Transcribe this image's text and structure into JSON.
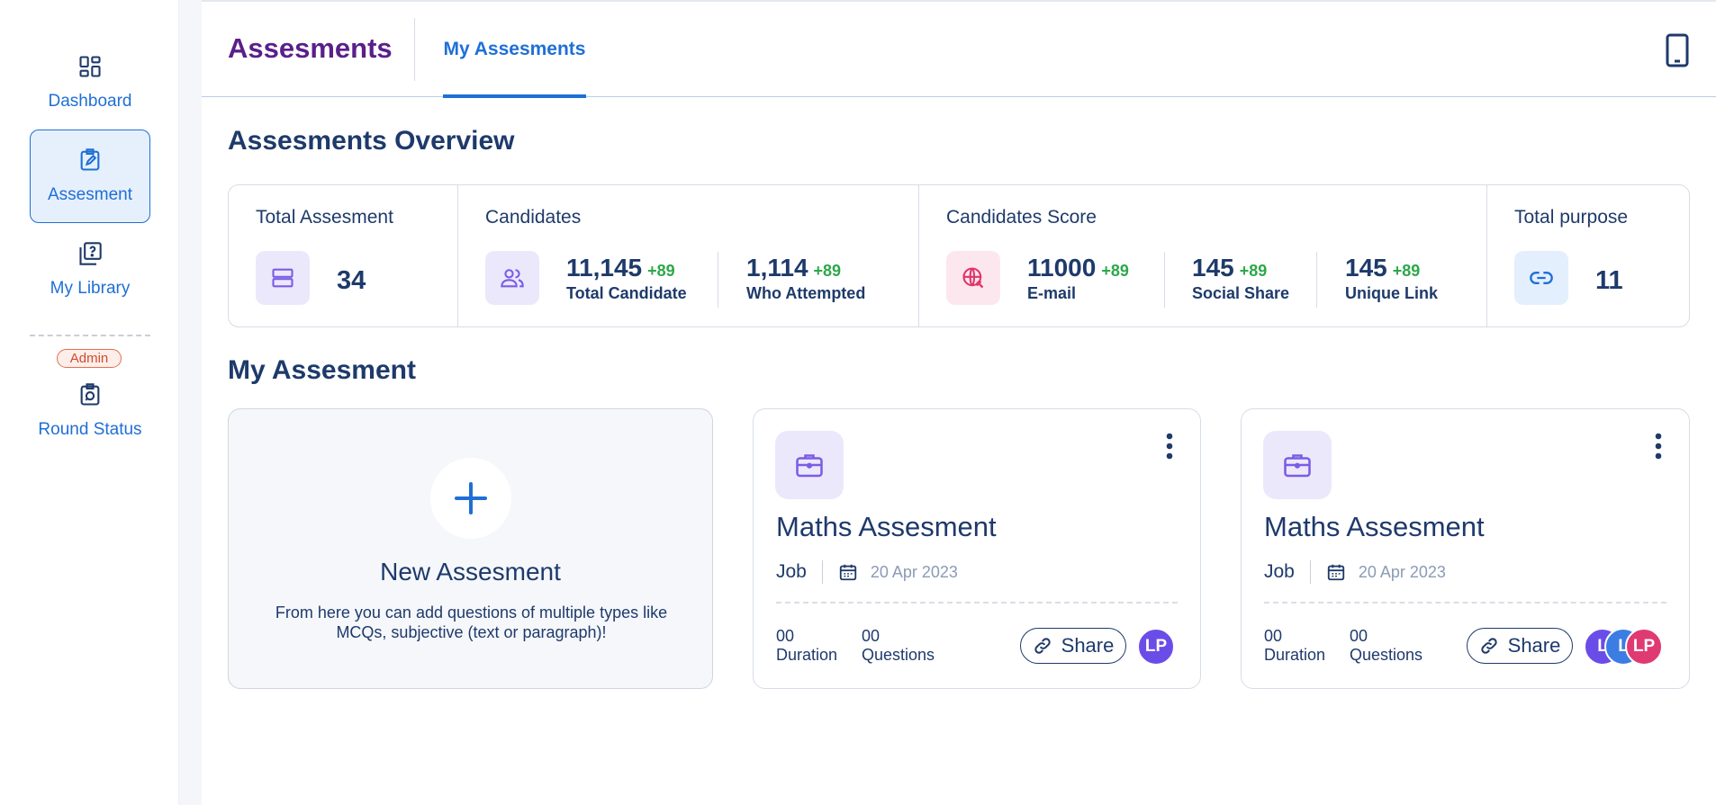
{
  "sidebar": {
    "items": [
      {
        "label": "Dashboard",
        "icon": "dashboard-icon"
      },
      {
        "label": "Assesment",
        "icon": "assessment-edit-icon"
      },
      {
        "label": "My Library",
        "icon": "library-question-icon"
      }
    ],
    "admin_badge": "Admin",
    "round_status": {
      "label": "Round Status",
      "icon": "round-status-icon"
    }
  },
  "header": {
    "app_title": "Assesments",
    "tab_label": "My Assesments",
    "mobile_icon": "mobile-icon"
  },
  "overview": {
    "title": "Assesments Overview",
    "total_assesment": {
      "label": "Total Assesment",
      "value": "34"
    },
    "candidates": {
      "label": "Candidates",
      "stats": [
        {
          "value": "11,145",
          "delta": "+89",
          "caption": "Total Candidate"
        },
        {
          "value": "1,114",
          "delta": "+89",
          "caption": "Who Attempted"
        }
      ]
    },
    "candidates_score": {
      "label": "Candidates Score",
      "stats": [
        {
          "value": "11000",
          "delta": "+89",
          "caption": "E-mail"
        },
        {
          "value": "145",
          "delta": "+89",
          "caption": "Social Share"
        },
        {
          "value": "145",
          "delta": "+89",
          "caption": "Unique Link"
        }
      ]
    },
    "total_purpose": {
      "label": "Total purpose",
      "value": "11"
    }
  },
  "my_assesment": {
    "title": "My Assesment",
    "new_card": {
      "title": "New Assesment",
      "description": "From here you can add questions of multiple types like MCQs, subjective (text or paragraph)!"
    },
    "cards": [
      {
        "title": "Maths Assesment",
        "type": "Job",
        "date": "20 Apr 2023",
        "duration_value": "00",
        "duration_label": "Duration",
        "questions_value": "00",
        "questions_label": "Questions",
        "share_label": "Share",
        "avatars": [
          "LP"
        ]
      },
      {
        "title": "Maths Assesment",
        "type": "Job",
        "date": "20 Apr 2023",
        "duration_value": "00",
        "duration_label": "Duration",
        "questions_value": "00",
        "questions_label": "Questions",
        "share_label": "Share",
        "avatars": [
          "L",
          "L",
          "LP"
        ]
      }
    ]
  },
  "colors": {
    "accent": "#1f6fd6",
    "brand_title": "#5a1f8a",
    "positive": "#2ba84a",
    "text": "#1e3a6b"
  }
}
